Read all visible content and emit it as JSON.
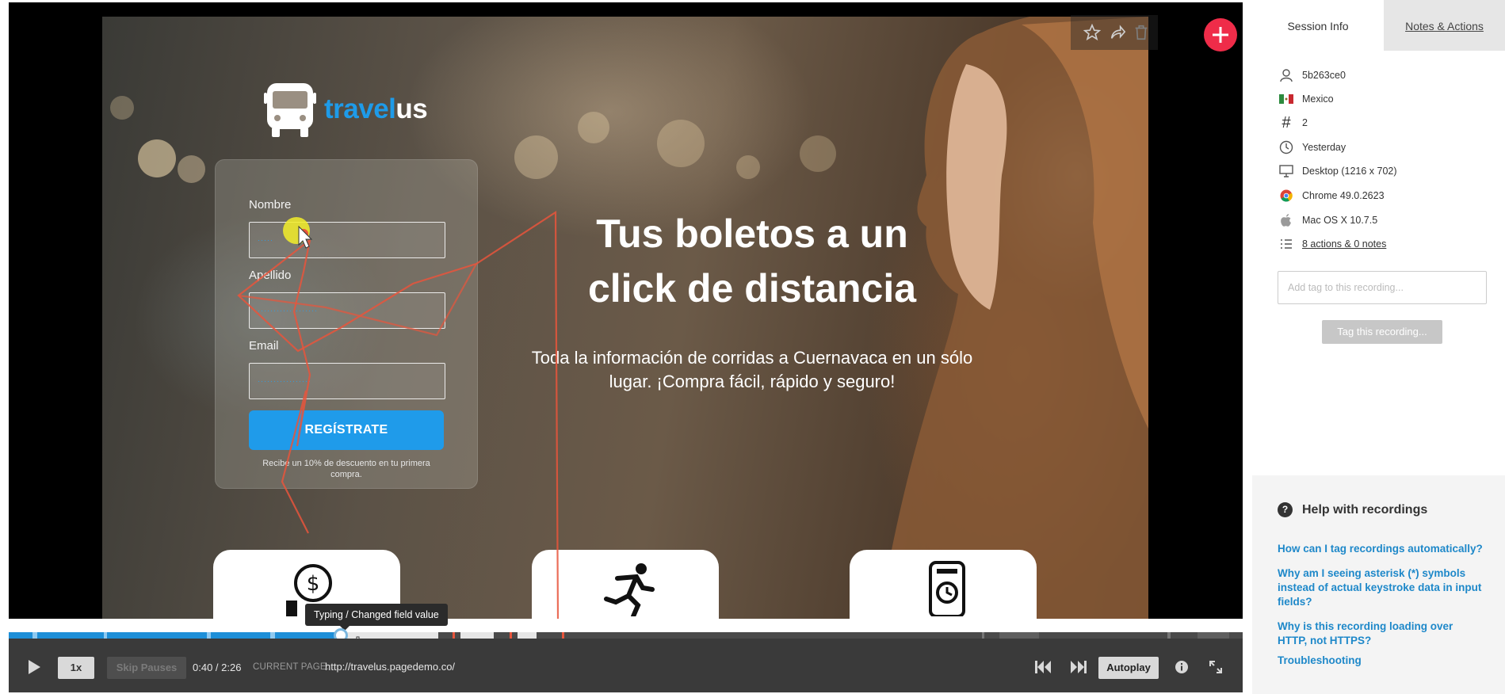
{
  "brand": {
    "part_a": "travel",
    "part_b": "us"
  },
  "form": {
    "nombre_label": "Nombre",
    "apellido_label": "Apellido",
    "email_label": "Email",
    "nombre_masked": "·····",
    "apellido_masked": "···················",
    "email_masked": "·················",
    "submit_label": "REGÍSTRATE",
    "discount_note": "Recibe un 10% de descuento en tu primera compra."
  },
  "hero": {
    "headline_line1": "Tus boletos a un",
    "headline_line2": "click de distancia",
    "subtext": "Toda la información de corridas a Cuernavaca en un sólo lugar. ¡Compra fácil, rápido y seguro!"
  },
  "top_tools": {
    "icons": [
      "star-icon",
      "share-icon",
      "trash-icon"
    ],
    "add_icon": "plus-icon"
  },
  "tooltip": {
    "text": "Typing / Changed field value"
  },
  "controls": {
    "speed": "1x",
    "skip_pauses": "Skip Pauses",
    "time": "0:40 / 2:26",
    "page_label": "CURRENT PAGE:",
    "page_url": "http://travelus.pagedemo.co/",
    "autoplay": "Autoplay",
    "progress_fraction": 0.274
  },
  "panel": {
    "tabs": {
      "session": "Session Info",
      "notes": "Notes & Actions"
    },
    "info": {
      "user_id": "5b263ce0",
      "country": "Mexico",
      "visits": "2",
      "when": "Yesterday",
      "device": "Desktop (1216 x 702)",
      "browser": "Chrome 49.0.2623",
      "os": "Mac OS X 10.7.5",
      "actions": "8 actions & 0 notes"
    },
    "tag_placeholder": "Add tag to this recording...",
    "tag_button": "Tag this recording...",
    "help": {
      "title": "Help with recordings",
      "links": [
        "How can I tag recordings automatically?",
        "Why am I seeing asterisk (*) symbols instead of actual keystroke data in input fields?",
        "Why is this recording loading over HTTP, not HTTPS?",
        "Troubleshooting"
      ]
    }
  },
  "colors": {
    "accent_blue": "#1f9bea",
    "add_red": "#ef2c49",
    "trail_red": "#e8553c",
    "link_blue": "#1e88c9"
  }
}
